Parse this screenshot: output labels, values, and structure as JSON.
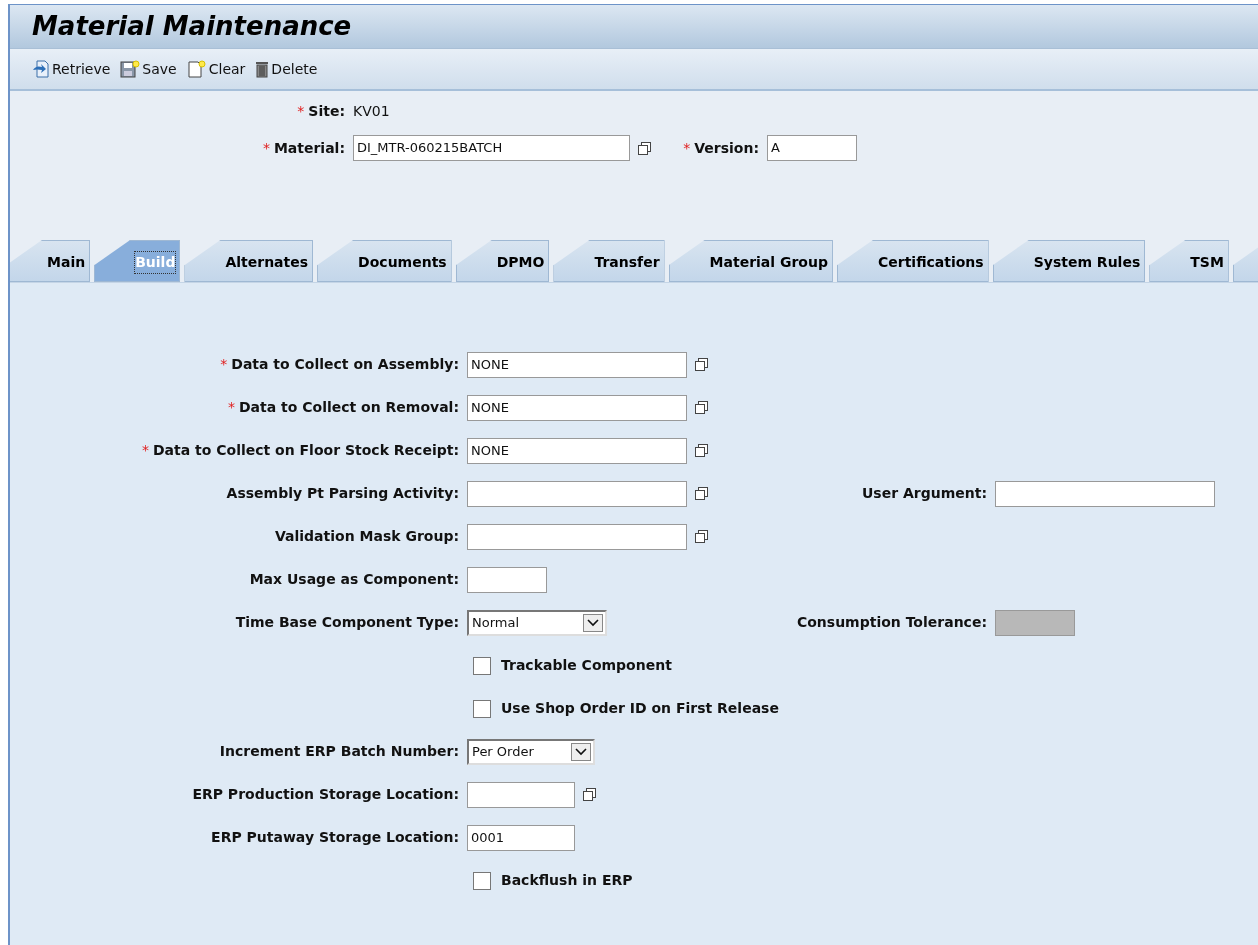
{
  "window": {
    "title": "Material Maintenance"
  },
  "toolbar": [
    {
      "label": "Retrieve",
      "kind": "retrieve"
    },
    {
      "label": "Save",
      "kind": "save"
    },
    {
      "label": "Clear",
      "kind": "clear"
    },
    {
      "label": "Delete",
      "kind": "delete"
    }
  ],
  "header": {
    "site": {
      "label": "Site:",
      "mark": "*",
      "value": "KV01"
    },
    "material": {
      "label": "Material:",
      "mark": "*",
      "value": "DI_MTR-060215BATCH"
    },
    "version": {
      "label": "Version:",
      "mark": "*",
      "value": "A"
    }
  },
  "tabs": [
    {
      "label": "Main",
      "selected": false
    },
    {
      "label": "Build",
      "selected": true
    },
    {
      "label": "Alternates",
      "selected": false
    },
    {
      "label": "Documents",
      "selected": false
    },
    {
      "label": "DPMO",
      "selected": false
    },
    {
      "label": "Transfer",
      "selected": false
    },
    {
      "label": "Material Group",
      "selected": false
    },
    {
      "label": "Certifications",
      "selected": false
    },
    {
      "label": "System Rules",
      "selected": false
    },
    {
      "label": "TSM",
      "selected": false
    },
    {
      "selected": false
    }
  ],
  "rows": [
    {
      "kind": "lookup",
      "label": "Data to Collect on Assembly:",
      "mark": "*",
      "value": "NONE"
    },
    {
      "kind": "lookup",
      "label": "Data to Collect on Removal:",
      "mark": "*",
      "value": "NONE"
    },
    {
      "kind": "lookup",
      "label": "Data to Collect on Floor Stock Receipt:",
      "mark": "*",
      "value": "NONE"
    },
    {
      "kind": "lookup",
      "label": "Assembly Pt Parsing Activity:",
      "side": {
        "kind": "text",
        "label": "User Argument:"
      }
    },
    {
      "kind": "lookup",
      "label": "Validation Mask Group:"
    },
    {
      "kind": "short",
      "label": "Max Usage as Component:"
    },
    {
      "kind": "select",
      "label": "Time Base Component Type:",
      "value": "Normal",
      "side": {
        "kind": "readonly",
        "label": "Consumption Tolerance:"
      }
    },
    {
      "kind": "checkbox",
      "label": "Trackable Component",
      "checked": false
    },
    {
      "kind": "checkbox",
      "label": "Use Shop Order ID on First Release",
      "checked": false
    },
    {
      "kind": "select-short",
      "label": "Increment ERP Batch Number:",
      "value": "Per Order"
    },
    {
      "kind": "lookup-short",
      "label": "ERP Production Storage Location:"
    },
    {
      "kind": "short-wide",
      "label": "ERP Putaway Storage Location:",
      "value": "0001"
    },
    {
      "kind": "checkbox",
      "label": "Backflush in ERP",
      "checked": false
    }
  ]
}
